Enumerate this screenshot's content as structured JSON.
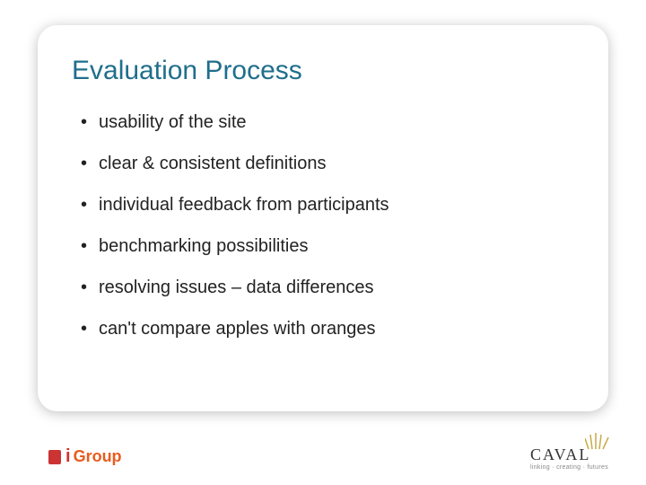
{
  "slide": {
    "title": "Evaluation Process",
    "bullets": [
      "usability of the site",
      "clear & consistent definitions",
      "individual feedback from participants",
      "benchmarking possibilities",
      "resolving issues – data differences",
      "can't compare apples with oranges"
    ]
  },
  "logos": {
    "left": {
      "i": "i",
      "rest": "Group"
    },
    "right": {
      "name": "CAVAL",
      "tagline": "linking · creating · futures"
    }
  },
  "icons": {
    "decorative": "scales-icon"
  }
}
